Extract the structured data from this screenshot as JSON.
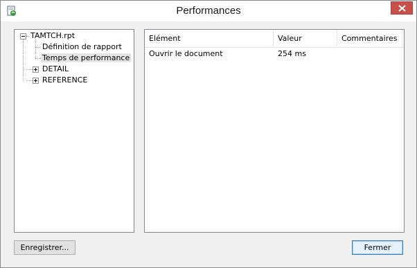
{
  "window": {
    "title": "Performances",
    "icon": "document-refresh-icon",
    "close_icon": "close-icon"
  },
  "tree": {
    "root": {
      "label": "TAMTCH.rpt",
      "expanded": true
    },
    "items": [
      {
        "label": "Définition de rapport",
        "selected": false,
        "expandable": false
      },
      {
        "label": "Temps de performance",
        "selected": true,
        "expandable": false
      },
      {
        "label": "DETAIL",
        "selected": false,
        "expandable": true
      },
      {
        "label": "REFERENCE",
        "selected": false,
        "expandable": true
      }
    ]
  },
  "table": {
    "columns": [
      "Elément",
      "Valeur",
      "Commentaires"
    ],
    "rows": [
      [
        "Ouvrir le document",
        "254 ms",
        ""
      ]
    ]
  },
  "buttons": {
    "save_label": "Enregistrer...",
    "close_label": "Fermer"
  },
  "colors": {
    "close_button": "#c7504a",
    "default_button_border": "#3c7fb1",
    "selection": "#e5e5e5"
  }
}
